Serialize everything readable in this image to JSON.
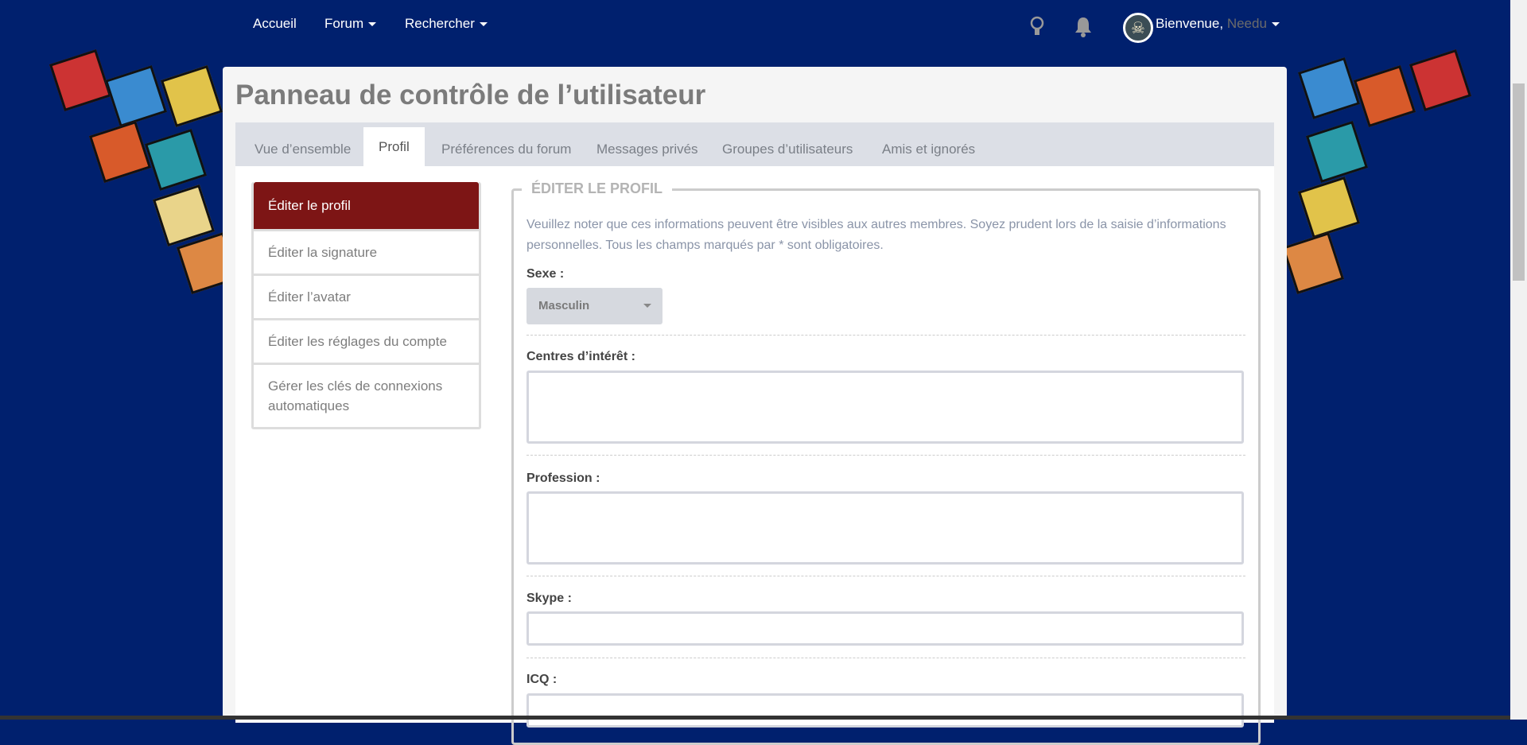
{
  "nav": {
    "items": [
      {
        "label": "Accueil"
      },
      {
        "label": "Forum"
      },
      {
        "label": "Rechercher"
      }
    ],
    "welcome": "Bienvenue,",
    "username": "Needu"
  },
  "panel": {
    "title": "Panneau de contrôle de l’utilisateur",
    "tabs": [
      "Vue d’ensemble",
      "Profil",
      "Préférences du forum",
      "Messages privés",
      "Groupes d’utilisateurs",
      "Amis et ignorés"
    ],
    "sidebar": [
      "Éditer le profil",
      "Éditer la signature",
      "Éditer l’avatar",
      "Éditer les réglages du compte",
      "Gérer les clés de connexions automatiques"
    ]
  },
  "form": {
    "legend": "ÉDITER LE PROFIL",
    "note": "Veuillez noter que ces informations peuvent être visibles aux autres membres. Soyez prudent lors de la saisie d’informations personnelles. Tous les champs marqués par * sont obligatoires.",
    "sexe_label": "Sexe :",
    "sexe_value": "Masculin",
    "interets_label": "Centres d’intérêt :",
    "profession_label": "Profession :",
    "skype_label": "Skype :",
    "icq_label": "ICQ :"
  },
  "colors": {
    "bg": "#00206e",
    "accent": "#7d1515"
  }
}
